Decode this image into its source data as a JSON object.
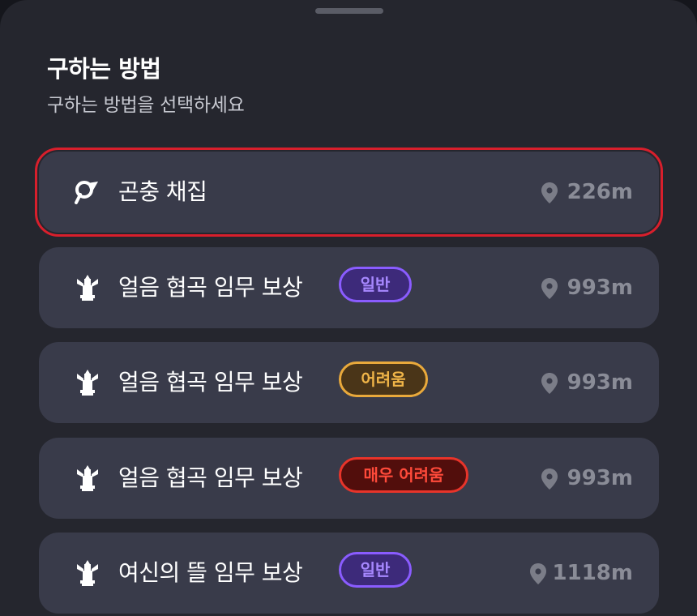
{
  "sheet": {
    "title": "구하는 방법",
    "subtitle": "구하는 방법을 선택하세요"
  },
  "items": [
    {
      "label": "곤충 채집",
      "badge": "",
      "distance": "226m",
      "icon": "insect-net-icon",
      "selected": true
    },
    {
      "label": "얼음 협곡 임무 보상",
      "badge": "일반",
      "badge_level": "normal",
      "distance": "993m",
      "icon": "statue-icon",
      "selected": false
    },
    {
      "label": "얼음 협곡 임무 보상",
      "badge": "어려움",
      "badge_level": "hard",
      "distance": "993m",
      "icon": "statue-icon",
      "selected": false
    },
    {
      "label": "얼음 협곡 임무 보상",
      "badge": "매우 어려움",
      "badge_level": "veryhard",
      "distance": "993m",
      "icon": "statue-icon",
      "selected": false
    },
    {
      "label": "여신의 뜰 임무 보상",
      "badge": "일반",
      "badge_level": "normal",
      "distance": "1118m",
      "icon": "statue-icon",
      "selected": false
    }
  ],
  "colors": {
    "selection_outline": "#d81f2c",
    "badge_normal": "#8a5cff",
    "badge_hard": "#e9a93b",
    "badge_veryhard": "#e8342a"
  }
}
